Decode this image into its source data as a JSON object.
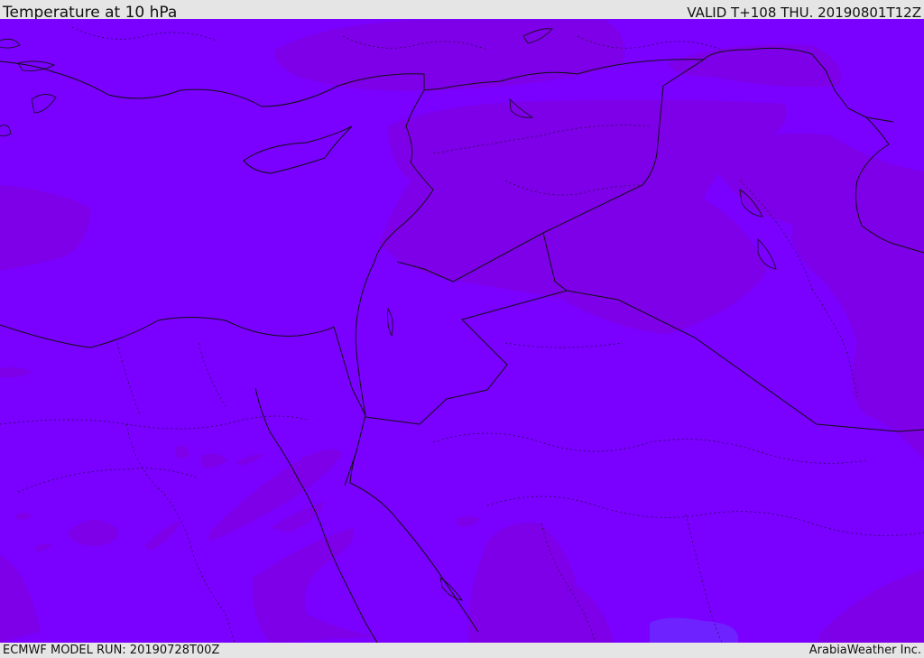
{
  "header": {
    "title": "Temperature at 10 hPa",
    "valid": "VALID T+108 THU. 20190801T12Z"
  },
  "footer": {
    "model_run": "ECMWF MODEL RUN: 20190728T00Z",
    "credit": "ArabiaWeather Inc."
  },
  "colors": {
    "field_base": "#7a00ff",
    "field_warm": "#7e00e8",
    "field_cool": "#6e22ff",
    "border": "#111111"
  }
}
